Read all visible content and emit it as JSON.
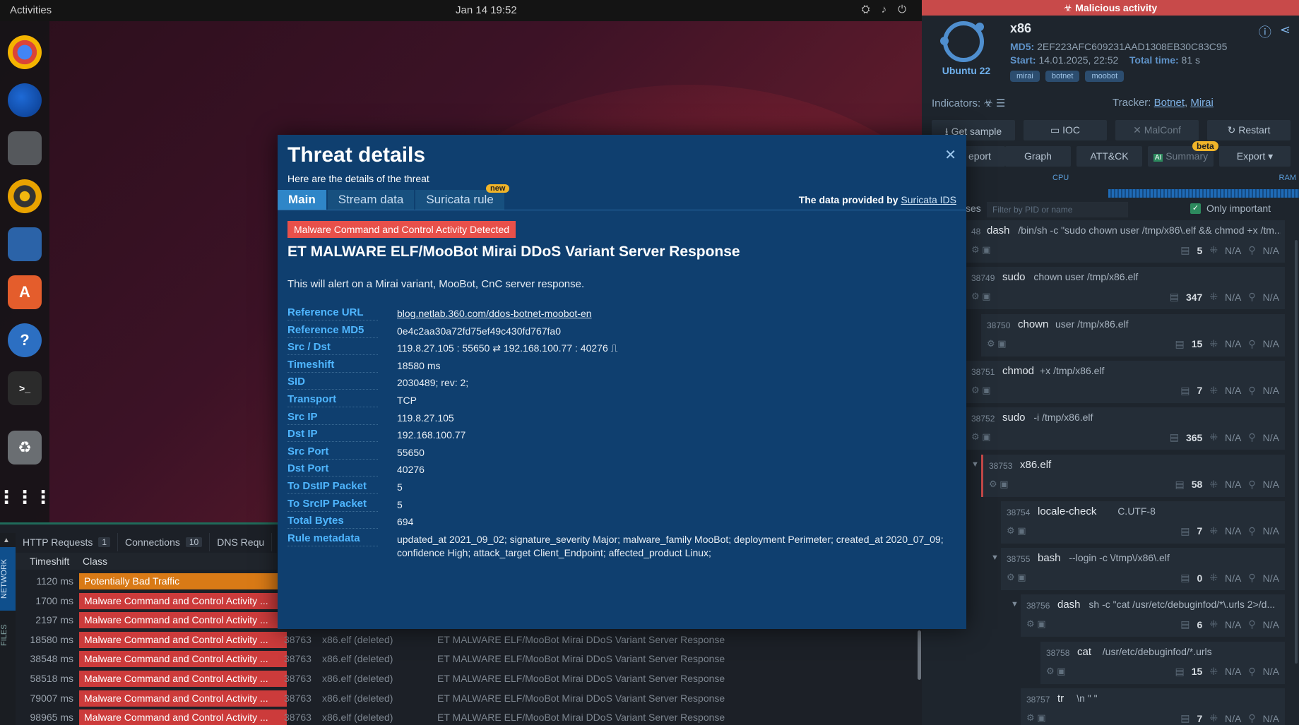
{
  "vm": {
    "topbar": {
      "activities": "Activities",
      "clock": "Jan 14  19:52"
    },
    "bottom_tabs": [
      {
        "label": "HTTP Requests",
        "count": "1"
      },
      {
        "label": "Connections",
        "count": "10"
      },
      {
        "label": "DNS Requ",
        "count": ""
      }
    ],
    "side_tabs": {
      "network": "NETWORK",
      "files": "FILES"
    },
    "columns": {
      "timeshift": "Timeshift",
      "class": "Class"
    },
    "events": [
      {
        "ts": "1120 ms",
        "cls": "Potentially Bad Traffic",
        "color": "#d97a16",
        "pid": "",
        "proc": "",
        "msg": ""
      },
      {
        "ts": "1700 ms",
        "cls": "Malware Command and Control Activity ...",
        "color": "#cc3b3b",
        "pid": "",
        "proc": "",
        "msg": ""
      },
      {
        "ts": "2197 ms",
        "cls": "Malware Command and Control Activity ...",
        "color": "#cc3b3b",
        "pid": "",
        "proc": "",
        "msg": ""
      },
      {
        "ts": "18580 ms",
        "cls": "Malware Command and Control Activity ...",
        "color": "#cc3b3b",
        "pid": "38763",
        "proc": "x86.elf (deleted)",
        "msg": "ET MALWARE ELF/MooBot Mirai DDoS Variant Server Response"
      },
      {
        "ts": "38548 ms",
        "cls": "Malware Command and Control Activity ...",
        "color": "#cc3b3b",
        "pid": "38763",
        "proc": "x86.elf (deleted)",
        "msg": "ET MALWARE ELF/MooBot Mirai DDoS Variant Server Response"
      },
      {
        "ts": "58518 ms",
        "cls": "Malware Command and Control Activity ...",
        "color": "#cc3b3b",
        "pid": "38763",
        "proc": "x86.elf (deleted)",
        "msg": "ET MALWARE ELF/MooBot Mirai DDoS Variant Server Response"
      },
      {
        "ts": "79007 ms",
        "cls": "Malware Command and Control Activity ...",
        "color": "#cc3b3b",
        "pid": "38763",
        "proc": "x86.elf (deleted)",
        "msg": "ET MALWARE ELF/MooBot Mirai DDoS Variant Server Response"
      },
      {
        "ts": "98965 ms",
        "cls": "Malware Command and Control Activity ...",
        "color": "#cc3b3b",
        "pid": "38763",
        "proc": "x86.elf (deleted)",
        "msg": "ET MALWARE ELF/MooBot Mirai DDoS Variant Server Response"
      }
    ]
  },
  "panel": {
    "banner": "Malicious activity",
    "os_name": "Ubuntu 22",
    "file_name": "x86",
    "md5_label": "MD5:",
    "md5": "2EF223AFC609231AAD1308EB30C83C95",
    "start_label": "Start:",
    "start": "14.01.2025, 22:52",
    "total_label": "Total time:",
    "total": "81 s",
    "tags": [
      "mirai",
      "botnet",
      "moobot"
    ],
    "indicators_label": "Indicators:",
    "tracker_label": "Tracker:",
    "trackers": [
      "Botnet",
      "Mirai"
    ],
    "buttons_row1": [
      "Get sample",
      "IOC",
      "MalConf",
      "Restart"
    ],
    "buttons_row2": [
      "eport",
      "Graph",
      "ATT&CK",
      "Summary",
      "Export ▾"
    ],
    "beta": "beta",
    "cpu": "CPU",
    "ram": "RAM",
    "processes_label": "ses",
    "filter_placeholder": "Filter by PID or name",
    "only_important": "Only important",
    "processes": [
      {
        "pid": "48",
        "name": "dash",
        "cmd": "/bin/sh -c \"sudo chown user /tmp/x86\\.elf && chmod +x /tm...",
        "n": "5"
      },
      {
        "pid": "38749",
        "name": "sudo",
        "cmd": "chown user /tmp/x86.elf",
        "n": "347"
      },
      {
        "pid": "38750",
        "name": "chown",
        "cmd": "user /tmp/x86.elf",
        "n": "15"
      },
      {
        "pid": "38751",
        "name": "chmod",
        "cmd": "+x /tmp/x86.elf",
        "n": "7"
      },
      {
        "pid": "38752",
        "name": "sudo",
        "cmd": "-i /tmp/x86.elf",
        "n": "365"
      },
      {
        "pid": "38753",
        "name": "x86.elf",
        "cmd": "",
        "n": "58"
      },
      {
        "pid": "38754",
        "name": "locale-check",
        "cmd": "C.UTF-8",
        "n": "7"
      },
      {
        "pid": "38755",
        "name": "bash",
        "cmd": "--login -c \\/tmp\\/x86\\.elf",
        "n": "0"
      },
      {
        "pid": "38756",
        "name": "dash",
        "cmd": "sh -c \"cat /usr/etc/debuginfod/*\\.urls 2>/d...",
        "n": "6"
      },
      {
        "pid": "38758",
        "name": "cat",
        "cmd": "/usr/etc/debuginfod/*.urls",
        "n": "15"
      },
      {
        "pid": "38757",
        "name": "tr",
        "cmd": "\\n \" \"",
        "n": "7"
      }
    ],
    "na": "N/A"
  },
  "modal": {
    "title": "Threat details",
    "subtitle": "Here are the details of the threat",
    "tabs": [
      "Main",
      "Stream data",
      "Suricata rule"
    ],
    "new_badge": "new",
    "provided_prefix": "The data provided by ",
    "provided_link": "Suricata IDS",
    "alert_class": "Malware Command and Control Activity Detected",
    "signature": "ET MALWARE ELF/MooBot Mirai DDoS Variant Server Response",
    "description": "This will alert on a Mirai variant, MooBot, CnC server response.",
    "fields": [
      {
        "key": "Reference URL",
        "value": "blog.netlab.360.com/ddos-botnet-moobot-en",
        "link": true
      },
      {
        "key": "Reference MD5",
        "value": "0e4c2aa30a72fd75ef49c430fd767fa0"
      },
      {
        "key": "Src / Dst",
        "value": "119.8.27.105 : 55650  ⇄  192.168.100.77 : 40276  ⎍"
      },
      {
        "key": "Timeshift",
        "value": "18580 ms"
      },
      {
        "key": "SID",
        "value": "2030489; rev: 2;"
      },
      {
        "key": "Transport",
        "value": "TCP"
      },
      {
        "key": "Src IP",
        "value": "119.8.27.105"
      },
      {
        "key": "Dst IP",
        "value": "192.168.100.77"
      },
      {
        "key": "Src Port",
        "value": "55650"
      },
      {
        "key": "Dst Port",
        "value": "40276"
      },
      {
        "key": "To DstIP Packet",
        "value": "5"
      },
      {
        "key": "To SrcIP Packet",
        "value": "5"
      },
      {
        "key": "Total Bytes",
        "value": "694"
      },
      {
        "key": "Rule metadata",
        "value": "updated_at 2021_09_02; signature_severity Major; malware_family MooBot; deployment Perimeter; created_at 2020_07_09; confidence High; attack_target Client_Endpoint; affected_product Linux;"
      }
    ]
  }
}
